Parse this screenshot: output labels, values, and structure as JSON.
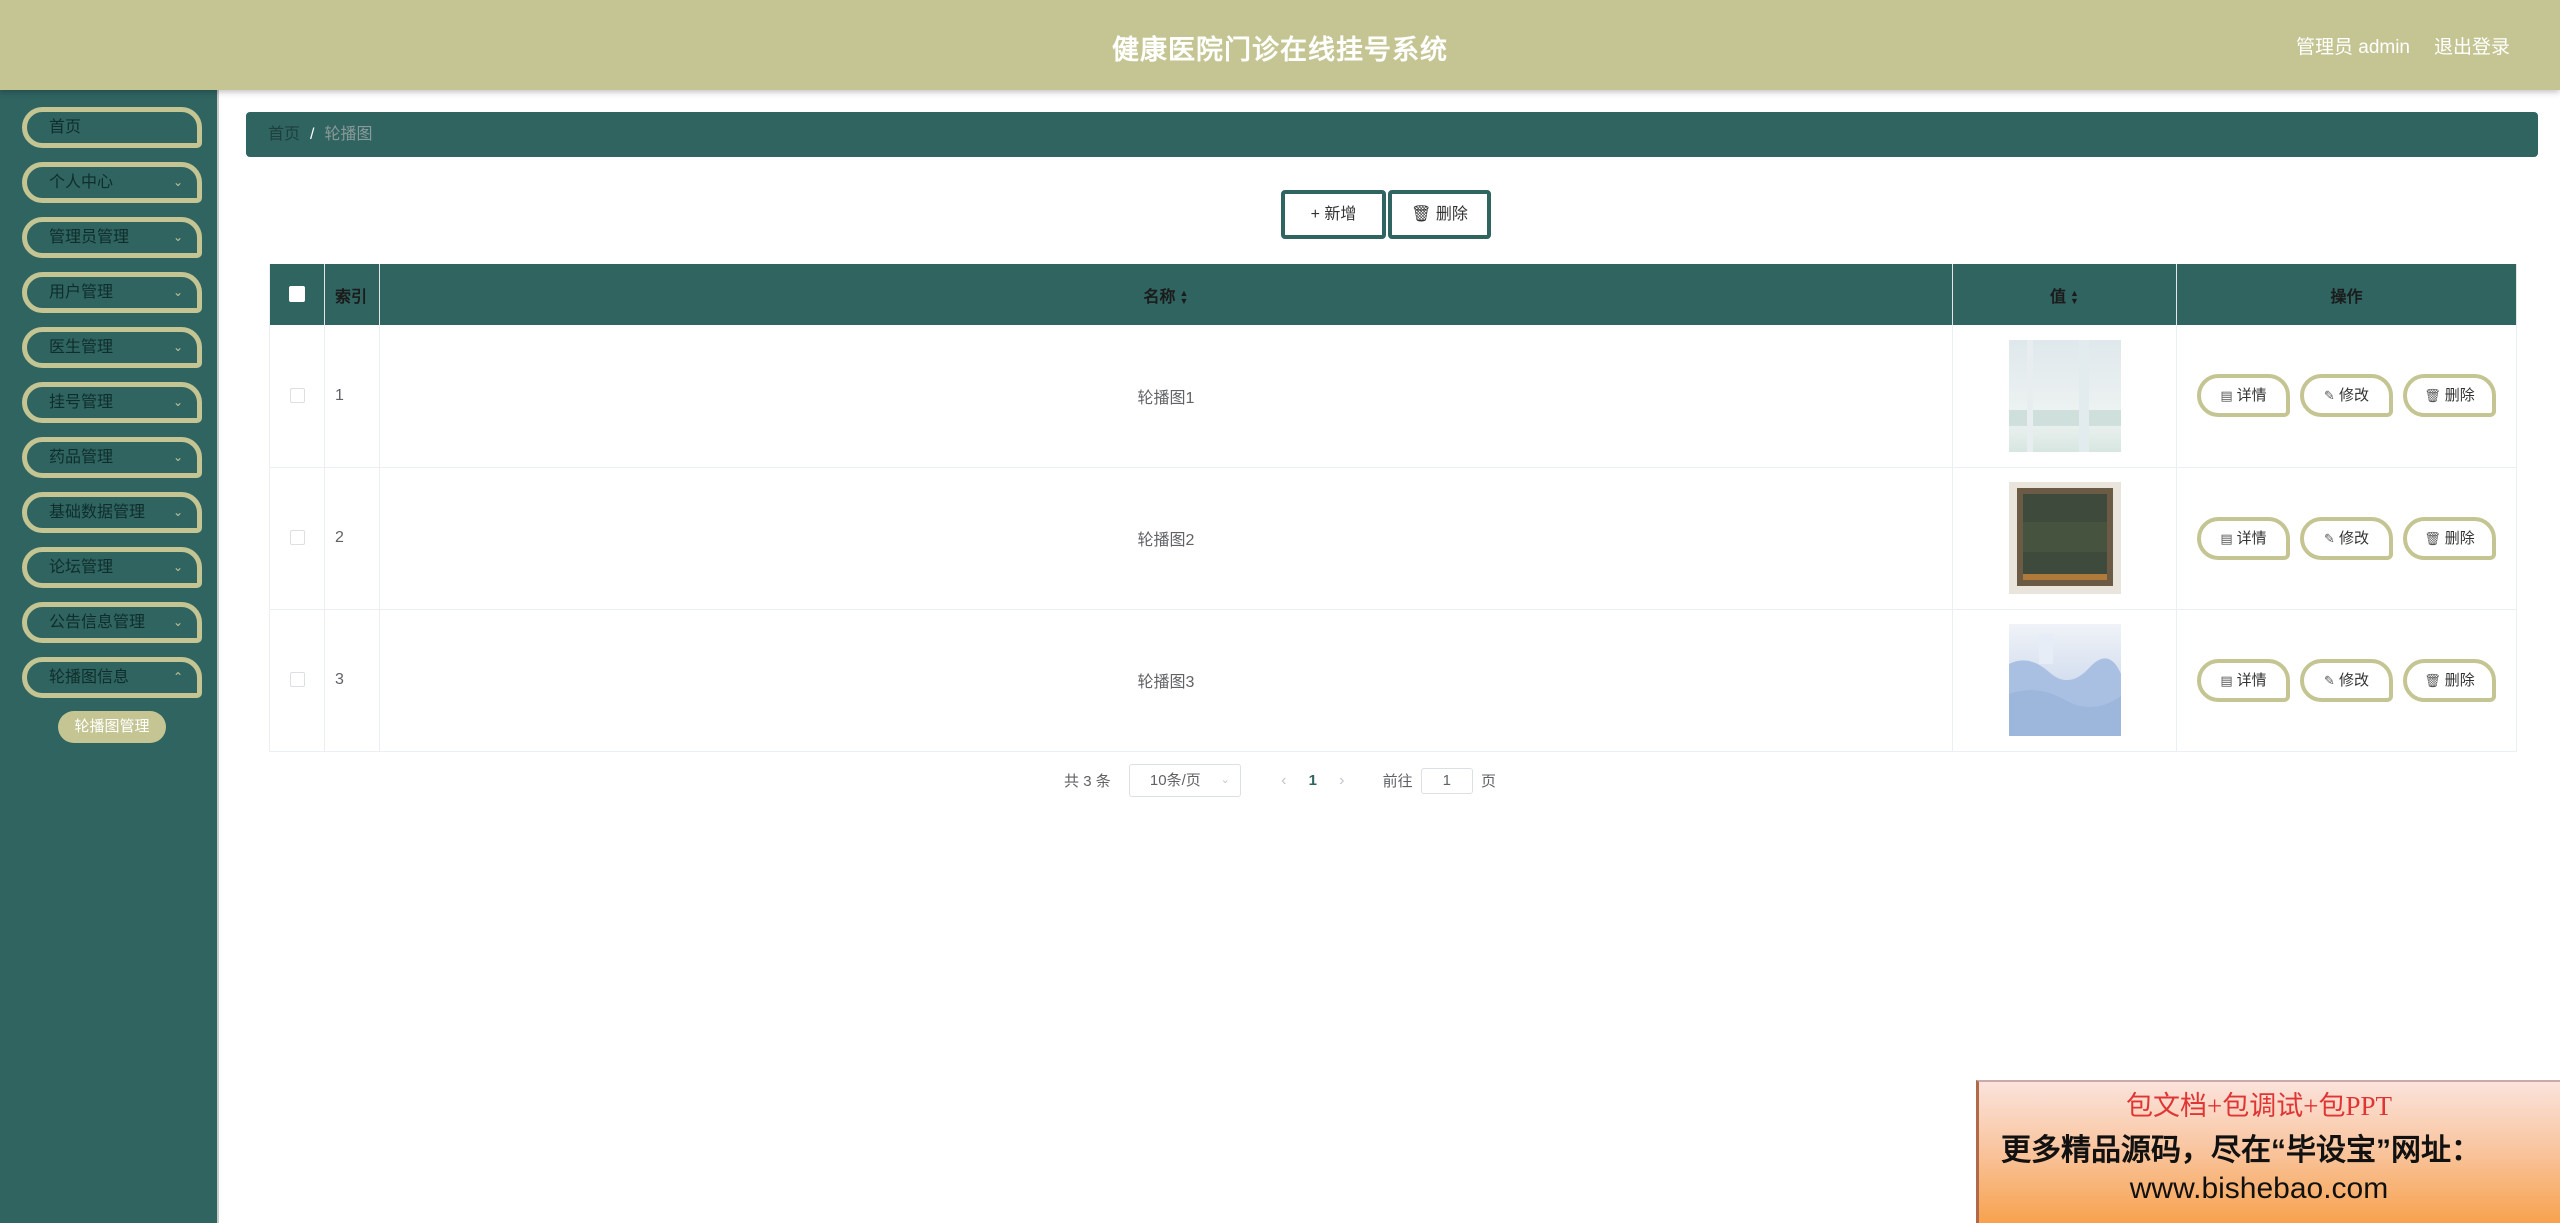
{
  "header": {
    "title": "健康医院门诊在线挂号系统",
    "user": "管理员 admin",
    "logout": "退出登录"
  },
  "sidebar": {
    "items": [
      {
        "label": "首页"
      },
      {
        "label": "个人中心"
      },
      {
        "label": "管理员管理"
      },
      {
        "label": "用户管理"
      },
      {
        "label": "医生管理"
      },
      {
        "label": "挂号管理"
      },
      {
        "label": "药品管理"
      },
      {
        "label": "基础数据管理"
      },
      {
        "label": "论坛管理"
      },
      {
        "label": "公告信息管理"
      },
      {
        "label": "轮播图信息"
      }
    ],
    "submenu": "轮播图管理"
  },
  "breadcrumb": {
    "home": "首页",
    "separator": "/",
    "current": "轮播图"
  },
  "toolbar": {
    "add_label": "新增",
    "delete_label": "删除"
  },
  "table": {
    "columns": {
      "index": "索引",
      "name": "名称",
      "value": "值",
      "actions": "操作"
    },
    "rows": [
      {
        "index": "1",
        "name": "轮播图1"
      },
      {
        "index": "2",
        "name": "轮播图2"
      },
      {
        "index": "3",
        "name": "轮播图3"
      }
    ],
    "actions": {
      "detail": "详情",
      "edit": "修改",
      "delete": "删除"
    }
  },
  "pagination": {
    "total": "共 3 条",
    "page_size": "10条/页",
    "current": "1",
    "goto_prefix": "前往",
    "goto_value": "1",
    "goto_suffix": "页"
  },
  "ad": {
    "line1": "包文档+包调试+包PPT",
    "line2": "更多精品源码，尽在“毕设宝”网址：",
    "line3": "www.bishebao.com"
  },
  "colors": {
    "primary": "#2f6461",
    "accent": "#c4c593"
  }
}
